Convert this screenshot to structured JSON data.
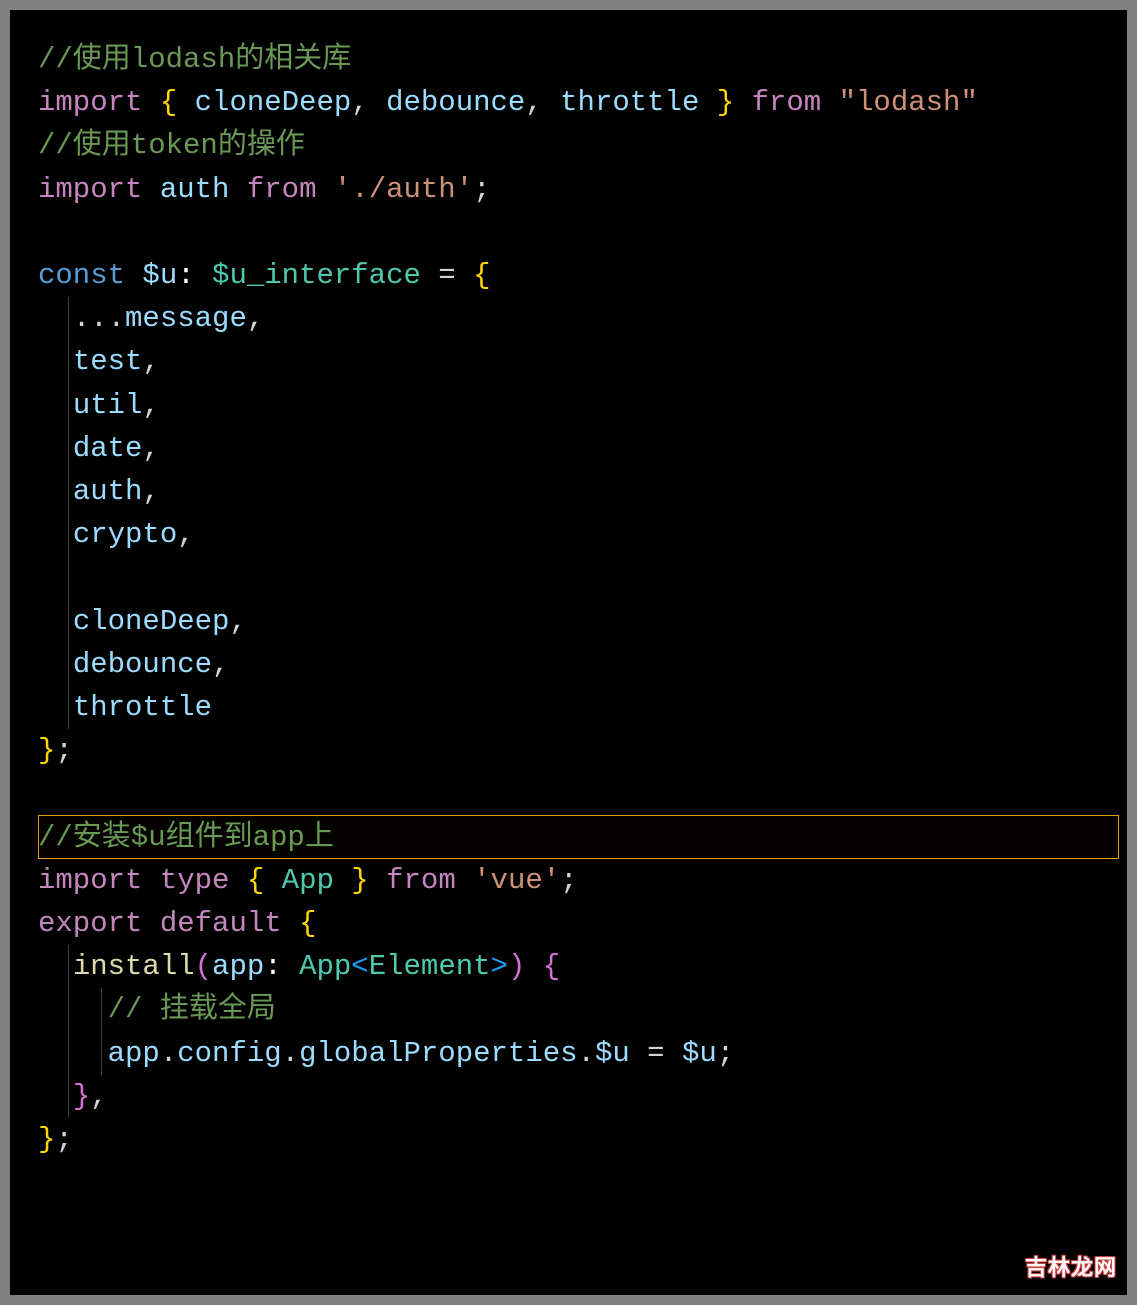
{
  "code": {
    "l1_comment": "//使用lodash的相关库",
    "l2_import": "import",
    "l2_brace_open": "{",
    "l2_id1": "cloneDeep",
    "l2_comma1": ",",
    "l2_id2": "debounce",
    "l2_comma2": ",",
    "l2_id3": "throttle",
    "l2_brace_close": "}",
    "l2_from": "from",
    "l2_str": "\"lodash\"",
    "l3_comment": "//使用token的操作",
    "l4_import": "import",
    "l4_id": "auth",
    "l4_from": "from",
    "l4_str": "'./auth'",
    "l4_semi": ";",
    "l6_const": "const",
    "l6_var": "$u",
    "l6_colon": ":",
    "l6_type": "$u_interface",
    "l6_eq": "=",
    "l6_brace": "{",
    "l7_spread": "...",
    "l7_id": "message",
    "l7_comma": ",",
    "l8_id": "test",
    "l8_comma": ",",
    "l9_id": "util",
    "l9_comma": ",",
    "l10_id": "date",
    "l10_comma": ",",
    "l11_id": "auth",
    "l11_comma": ",",
    "l12_id": "crypto",
    "l12_comma": ",",
    "l14_id": "cloneDeep",
    "l14_comma": ",",
    "l15_id": "debounce",
    "l15_comma": ",",
    "l16_id": "throttle",
    "l17_brace": "}",
    "l17_semi": ";",
    "l19_comment": "//安装$u组件到app上",
    "l20_import": "import",
    "l20_type_kw": "type",
    "l20_brace_open": "{",
    "l20_id": "App",
    "l20_brace_close": "}",
    "l20_from": "from",
    "l20_str": "'vue'",
    "l20_semi": ";",
    "l21_export": "export",
    "l21_default": "default",
    "l21_brace": "{",
    "l22_func": "install",
    "l22_paren_open": "(",
    "l22_param": "app",
    "l22_colon": ":",
    "l22_type1": "App",
    "l22_angle_open": "<",
    "l22_type2": "Element",
    "l22_angle_close": ">",
    "l22_paren_close": ")",
    "l22_brace": "{",
    "l23_comment": "// 挂载全局",
    "l24_obj": "app",
    "l24_dot1": ".",
    "l24_prop1": "config",
    "l24_dot2": ".",
    "l24_prop2": "globalProperties",
    "l24_dot3": ".",
    "l24_prop3": "$u",
    "l24_eq": "=",
    "l24_val": "$u",
    "l24_semi": ";",
    "l25_brace": "}",
    "l25_comma": ",",
    "l26_brace": "}",
    "l26_semi": ";"
  },
  "watermark": "吉林龙网"
}
